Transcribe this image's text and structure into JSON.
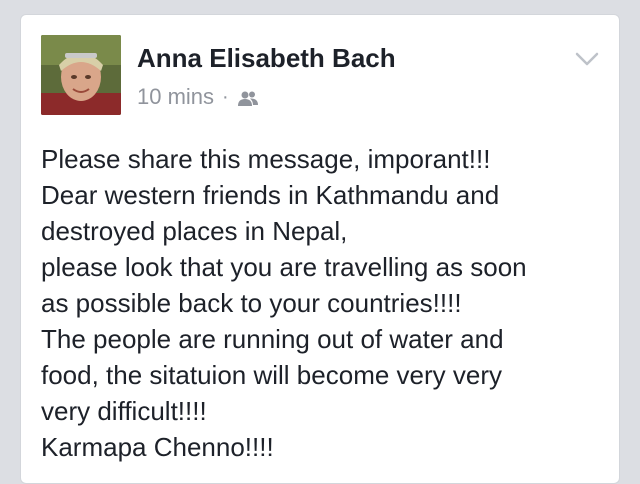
{
  "post": {
    "author": "Anna Elisabeth Bach",
    "time": "10 mins",
    "separator": "·",
    "audience_icon": "friends-icon",
    "menu_icon": "chevron-down-icon",
    "lines": [
      "Please share this message, imporant!!!",
      "Dear western friends in Kathmandu and",
      "destroyed places in Nepal,",
      "please look that you are travelling as soon",
      "as possible back to your countries!!!!",
      "The people are running out of water and",
      "food, the sitatuion will become very very",
      "very difficult!!!!",
      "Karmapa Chenno!!!!"
    ]
  },
  "colors": {
    "background": "#dcdee3",
    "card": "#ffffff",
    "name": "#1d2129",
    "meta": "#90949c",
    "text": "#1d2129"
  }
}
